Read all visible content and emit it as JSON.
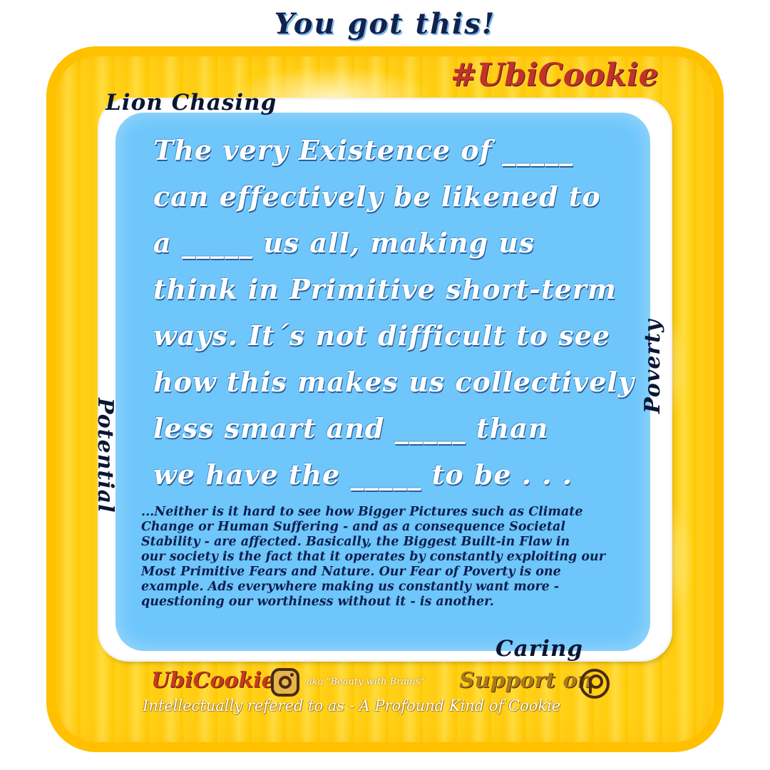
{
  "top_heading": "You got this!",
  "hashtag": "#UbiCookie",
  "main_quote": {
    "lines": [
      "The very Existence of _____",
      "can effectively be likened to",
      "a _____ us all, making us",
      "think in Primitive short-term",
      "ways. It´s not difficult to see",
      "how this makes us collectively",
      "less smart and _____ than",
      "we have the _____ to be . . ."
    ]
  },
  "sub_quote": {
    "lines": [
      "...Neither is it hard to see how Bigger Pictures such as Climate",
      "Change or Human Suffering - and as a consequence Societal",
      "Stability - are affected. Basically, the Biggest Built-in Flaw in",
      "our society is the fact that it operates by constantly exploiting our",
      "Most Primitive Fears and Nature. Our Fear of Poverty is one",
      "example. Ads everywhere making us constantly want more -",
      "questioning our worthiness without it - is another."
    ]
  },
  "side_labels": {
    "top": "Lion Chasing",
    "right": "Poverty",
    "left": "Potential",
    "bottom": "Caring"
  },
  "footer": {
    "brand": "UbiCookie",
    "aka": "aka \"Beauty with Brains\"",
    "support": "Support on",
    "tagline": "Intellectually refered to as - A Profound Kind of Cookie",
    "icons": [
      "instagram-icon",
      "patreon-icon"
    ]
  },
  "colors": {
    "tray_yellow": "#ffd21a",
    "card_blue": "#6ec6fb",
    "heading_navy": "#11224f",
    "hashtag_red": "#c0322a"
  }
}
